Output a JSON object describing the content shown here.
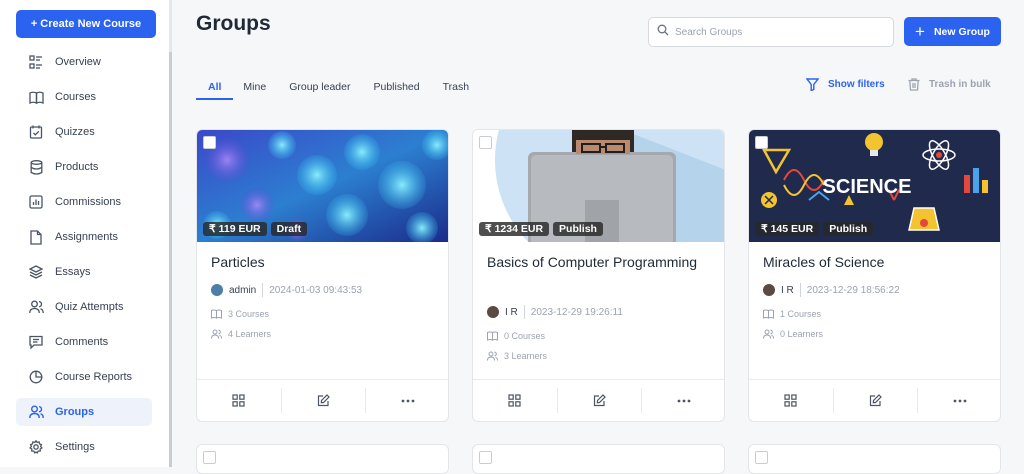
{
  "sidebar": {
    "create_label": "+ Create New Course",
    "items": [
      {
        "label": "Overview",
        "icon": "overview-icon"
      },
      {
        "label": "Courses",
        "icon": "book-icon"
      },
      {
        "label": "Quizzes",
        "icon": "quiz-icon"
      },
      {
        "label": "Products",
        "icon": "database-icon"
      },
      {
        "label": "Commissions",
        "icon": "chart-icon"
      },
      {
        "label": "Assignments",
        "icon": "file-icon"
      },
      {
        "label": "Essays",
        "icon": "layers-icon"
      },
      {
        "label": "Quiz Attempts",
        "icon": "users-icon"
      },
      {
        "label": "Comments",
        "icon": "comment-icon"
      },
      {
        "label": "Course Reports",
        "icon": "pie-icon"
      },
      {
        "label": "Groups",
        "icon": "group-icon"
      },
      {
        "label": "Settings",
        "icon": "gear-icon"
      }
    ],
    "active": "Groups"
  },
  "header": {
    "title": "Groups",
    "search_placeholder": "Search Groups",
    "new_group_label": "New Group"
  },
  "tabs": [
    "All",
    "Mine",
    "Group leader",
    "Published",
    "Trash"
  ],
  "active_tab": "All",
  "toolbar": {
    "show_filters": "Show filters",
    "trash_bulk": "Trash in bulk"
  },
  "colors": {
    "accent": "#2b63f0"
  },
  "cards": [
    {
      "price": "₹ 119 EUR",
      "status": "Draft",
      "title": "Particles",
      "author": "admin",
      "date": "2024-01-03 09:43:53",
      "courses": "3 Courses",
      "learners": "4 Learners"
    },
    {
      "price": "₹ 1234 EUR",
      "status": "Publish",
      "title": "Basics of Computer Programming",
      "author": "I R",
      "date": "2023-12-29 19:26:11",
      "courses": "0 Courses",
      "learners": "3 Learners"
    },
    {
      "price": "₹ 145 EUR",
      "status": "Publish",
      "title": "Miracles of Science",
      "author": "I R",
      "date": "2023-12-29 18:56:22",
      "courses": "1 Courses",
      "learners": "0 Learners"
    }
  ],
  "thumb_texts": {
    "science": "SCIENCE"
  }
}
